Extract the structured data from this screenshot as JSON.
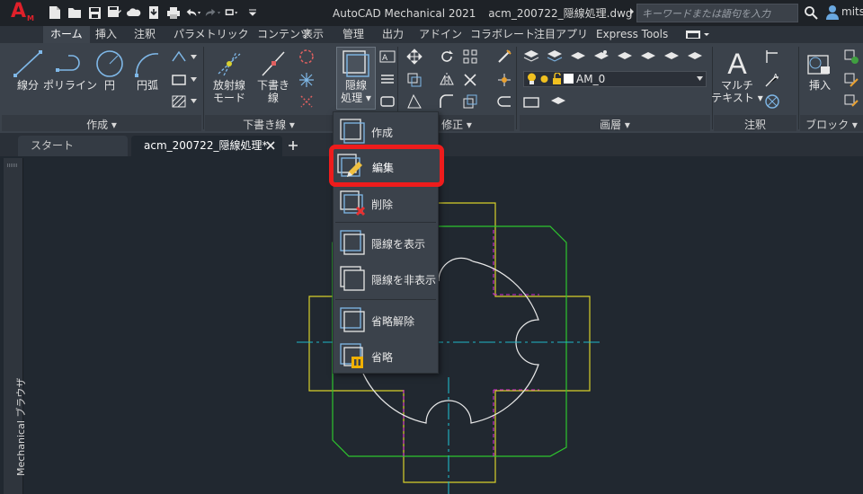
{
  "titlebar": {
    "app_logo_letter": "A",
    "app_logo_sub": "M",
    "app_name": "AutoCAD Mechanical 2021",
    "file_name": "acm_200722_隠線処理.dwg",
    "search_placeholder": "キーワードまたは語句を入力",
    "user_name": "mits"
  },
  "tabs": [
    "ホーム",
    "挿入",
    "注釈",
    "パラメトリック",
    "コンテンツ",
    "表示",
    "管理",
    "出力",
    "アドイン",
    "コラボレート",
    "注目アプリ",
    "Express Tools"
  ],
  "ribbon": {
    "draw_tools": {
      "line": "線分",
      "polyline": "ポリライン",
      "circle": "円",
      "arc": "円弧"
    },
    "construction_tools": {
      "radial": [
        "放射線",
        "モード"
      ],
      "draft": [
        "下書き",
        "線"
      ]
    },
    "hidden_tool": [
      "隠線",
      "処理"
    ],
    "text_tool": [
      "マルチ",
      "テキスト"
    ],
    "insert_tool": "挿入",
    "layer_name": "AM_0",
    "panels": {
      "draw": "作成",
      "construction": "下書き線",
      "modify": "修正",
      "layer": "画層",
      "annotation": "注釈",
      "block": "ブロック"
    }
  },
  "doc_tabs": {
    "start": "スタート",
    "file": "acm_200722_隠線処理*"
  },
  "side_palette": {
    "label": "Mechanical ブラウザ"
  },
  "menu": {
    "items": [
      {
        "label": "作成",
        "icon": "hide-create-icon"
      },
      {
        "label": "編集",
        "icon": "hide-edit-icon",
        "highlighted": true
      },
      {
        "label": "削除",
        "icon": "hide-delete-icon"
      },
      {
        "label": "隠線を表示",
        "icon": "hide-show-icon"
      },
      {
        "label": "隠線を非表示",
        "icon": "hide-hide-icon"
      },
      {
        "label": "省略解除",
        "icon": "unsuppress-icon"
      },
      {
        "label": "省略",
        "icon": "suppress-icon"
      }
    ]
  },
  "colors": {
    "highlight_border": "#ee1c1c",
    "geometry_yellow": "#d8d02a",
    "geometry_green": "#2ec52e",
    "geometry_white": "#e8e8e8",
    "geometry_magenta": "#d22ad2",
    "centerline_cyan": "#1fb8c8"
  }
}
